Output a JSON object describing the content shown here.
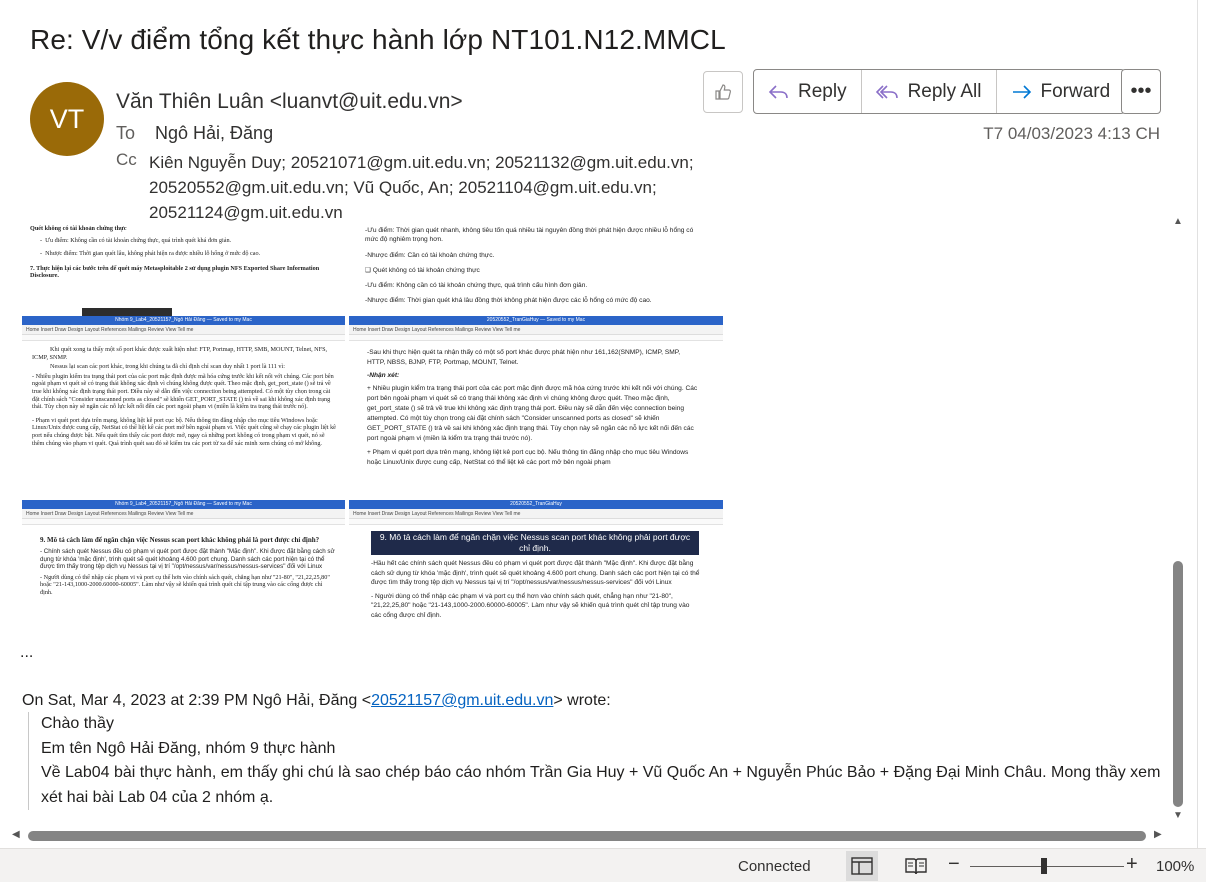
{
  "message": {
    "subject": "Re: V/v điểm tổng kết thực hành lớp NT101.N12.MMCL",
    "avatar_initials": "VT",
    "avatar_color": "#9a6a08",
    "sender": "Văn Thiên Luân <luanvt@uit.edu.vn>",
    "to_label": "To",
    "to_value": "Ngô Hải, Đăng",
    "cc_label": "Cc",
    "cc_value": "Kiên Nguyễn Duy; 20521071@gm.uit.edu.vn; 20521132@gm.uit.edu.vn; 20520552@gm.uit.edu.vn; Vũ Quốc, An; 20521104@gm.uit.edu.vn; 20521124@gm.uit.edu.vn",
    "date": "T7 04/03/2023 4:13 CH"
  },
  "actions": {
    "reply": "Reply",
    "reply_all": "Reply All",
    "forward": "Forward",
    "accent_color": "#0078d4"
  },
  "embedded": {
    "left_top": {
      "heading": "Quét không có tài khoản chứng thực",
      "bullet1": "Ưu điểm: Không cần có tài khoản chứng thực, quá trình quét khá đơn giản.",
      "bullet2": "Nhược điểm: Thời gian quét lâu, không phát hiện ra được nhiều lỗ hổng ở mức độ cao.",
      "step7": "7.   Thực hiện lại các bước trên để quét máy Metasploitable 2 sử dụng plugin NFS Exported Share Information Disclosure."
    },
    "right_top": {
      "line1": "-Ưu điểm: Thời gian quét nhanh, không tiêu tốn quá nhiều tài nguyên đồng thời phát hiện được nhiều lỗ hổng có mức độ nghiêm trọng hơn.",
      "line2": "-Nhược điểm: Cần có tài khoản chứng thực.",
      "line3": "❑ Quét không có tài khoản chứng thực",
      "line4": "-Ưu điểm: Không cần có tài khoản chứng thực, quá trình cấu hình đơn giản.",
      "line5": "-Nhược điểm: Thời gian quét khá lâu đồng thời không phát hiện được các lỗ hổng có mức độ cao."
    },
    "left_mid": {
      "title_bar": "Nhóm 9_Lab4_20521157_Ngô Hải Đăng — Saved to my Mac",
      "ribbon": "Home   Insert   Draw   Design   Layout   References   Mailings   Review   View   Tell me",
      "p1": "Khi quét xong ta thấy một số port khác được xuất hiện như: FTP, Portmap, HTTP, SMB, MOUNT, Telnet, NFS, ICMP, SNMP.",
      "p2": "Nessus lại scan các port khác, trong khi chúng ta đã chỉ định chỉ scan duy nhất 1 port là 111 vì:",
      "p3": "- Nhiều plugin kiểm tra trạng thái port của các port mặc định được mã hóa cứng trước khi kết nối với chúng. Các port bên ngoài phạm vi quét sẽ có trạng thái không xác định vì chúng không được quét. Theo mặc định, get_port_state () sẽ trả về true khi không xác định trạng thái port. Điều này sẽ dẫn đến việc connection being attempted. Có một tùy chọn trong cài đặt chính sách \"Consider unscanned ports as closed\" sẽ khiến GET_PORT_STATE () trả về sai khi không xác định trạng thái. Tùy chọn này sẽ ngăn các nỗ lực kết nối đến các port ngoài phạm vi (miền là kiểm tra trạng thái trước nó).",
      "p4": "- Phạm vi quét port dựa trên mạng, không liệt kê port cục bộ. Nếu thông tin đăng nhập cho mục tiêu Windows hoặc Linux/Unix được cung cấp, NetStat có thể liệt kê các port mở bên ngoài phạm vi. Việc quét cũng sẽ chạy các plugin liệt kê port nếu chúng được bật. Nếu quét tìm thấy các port được mở, ngay cả những port không có trong phạm vi quét, nó sẽ thêm chúng vào phạm vi quét. Quá trình quét sau đó sẽ kiểm tra các port từ xa để xác minh xem chúng có mở không."
    },
    "right_mid": {
      "title_bar": "20520552_TranGiaHuy — Saved to my Mac",
      "ribbon": "Home   Insert   Draw   Design   Layout   References   Mailings   Review   View   Tell me",
      "p1": "-Sau khi thực hiện quét ta nhận thấy có một số port khác được phát hiện như 161,162(SNMP), ICMP, SMP, HTTP, NBSS, BJNP, FTP, Portmap, MOUNT, Telnet.",
      "p2": "-Nhận xét:",
      "p3": "+ Nhiều plugin kiểm tra trạng thái port của các port mặc định được mã hóa cứng trước khi kết nối với chúng. Các port bên ngoài phạm vi quét sẽ có trạng thái không xác định vì chúng không được quét. Theo mặc định, get_port_state () sẽ trả về true khi không xác định trạng thái port. Điều này sẽ dẫn đến việc connection being attempted. Có một tùy chọn trong cài đặt chính sách \"Consider unscanned ports as closed\" sẽ khiến GET_PORT_STATE () trả về sai khi không xác định trạng thái. Tùy chọn này sẽ ngăn các nỗ lực kết nối đến các port ngoài phạm vi (miền là kiểm tra trạng thái trước nó).",
      "p4": "+ Phạm vi quét port dựa trên mạng, không liệt kê port cục bộ. Nếu thông tin đăng nhập cho mục tiêu Windows hoặc Linux/Unix được cung cấp, NetStat có thể liệt kê các port mở bên ngoài phạm"
    },
    "left_bot": {
      "title_bar": "Nhóm 9_Lab4_20521157_Ngô Hải Đăng — Saved to my Mac",
      "heading": "9.   Mô tả cách làm để ngăn chặn việc Nessus scan port khác không phải là port được chỉ định?",
      "p1": "- Chính sách quét Nessus đều có phạm vi quét port được đặt thành \"Mặc định\". Khi được đặt bằng cách sử dụng từ khóa 'mặc định', trình quét sẽ quét khoảng 4.600 port chung. Danh sách các port hiện tại có thể được tìm thấy trong tệp dịch vụ Nessus tại vị trí \"/opt/nessus/var/nessus/nessus-services\" đối với Linux",
      "p2": "- Người dùng có thể nhập các phạm vi và port cụ thể hơn vào chính sách quét, chẳng hạn như \"21-80\", \"21,22,25,80\" hoặc \"21-143,1000-2000.60000-60005\". Làm như vậy sẽ khiến quá trình quét chỉ tập trung vào các cổng được chỉ định."
    },
    "right_bot": {
      "title_bar": "20520552_TranGiaHuy",
      "heading": "9. Mô tả cách làm để ngăn chặn việc Nessus scan port khác không phải port được chỉ định.",
      "p1": "-Hầu hết các chính sách quét Nessus đều có phạm vi quét port được đặt thành \"Mặc định\". Khi được đặt bằng cách sử dụng từ khóa 'mặc định', trình quét sẽ quét khoảng 4.600 port chung. Danh sách các port hiện tại có thể được tìm thấy trong tệp dịch vụ Nessus tại vị trí \"/opt/nessus/var/nessus/nessus-services\" đối với Linux",
      "p2": "- Người dùng có thể nhập các phạm vi và port cụ thể hơn vào chính sách quét, chẳng hạn như \"21-80\", \"21,22,25,80\" hoặc \"21-143,1000-2000.60000-60005\". Làm như vậy sẽ khiến quá trình quét chỉ tập trung vào các cổng được chỉ định."
    }
  },
  "body": {
    "ellipsis": "...",
    "quote_prefix": "On Sat, Mar 4, 2023 at 2:39 PM Ngô Hải, Đăng <",
    "quote_email": "20521157@gm.uit.edu.vn",
    "quote_suffix": "> wrote:",
    "quote_lines": [
      "Chào thầy",
      "Em tên Ngô Hải Đăng, nhóm 9 thực hành",
      "Về Lab04 bài thực hành, em thấy ghi chú là sao chép báo cáo nhóm Trần Gia Huy + Vũ Quốc An + Nguyễn Phúc Bảo + Đặng Đại Minh Châu. Mong thầy xem xét hai bài Lab 04 của 2 nhóm ạ."
    ]
  },
  "status": {
    "connection": "Connected",
    "zoom": "100%",
    "zoom_value": 0.5
  }
}
